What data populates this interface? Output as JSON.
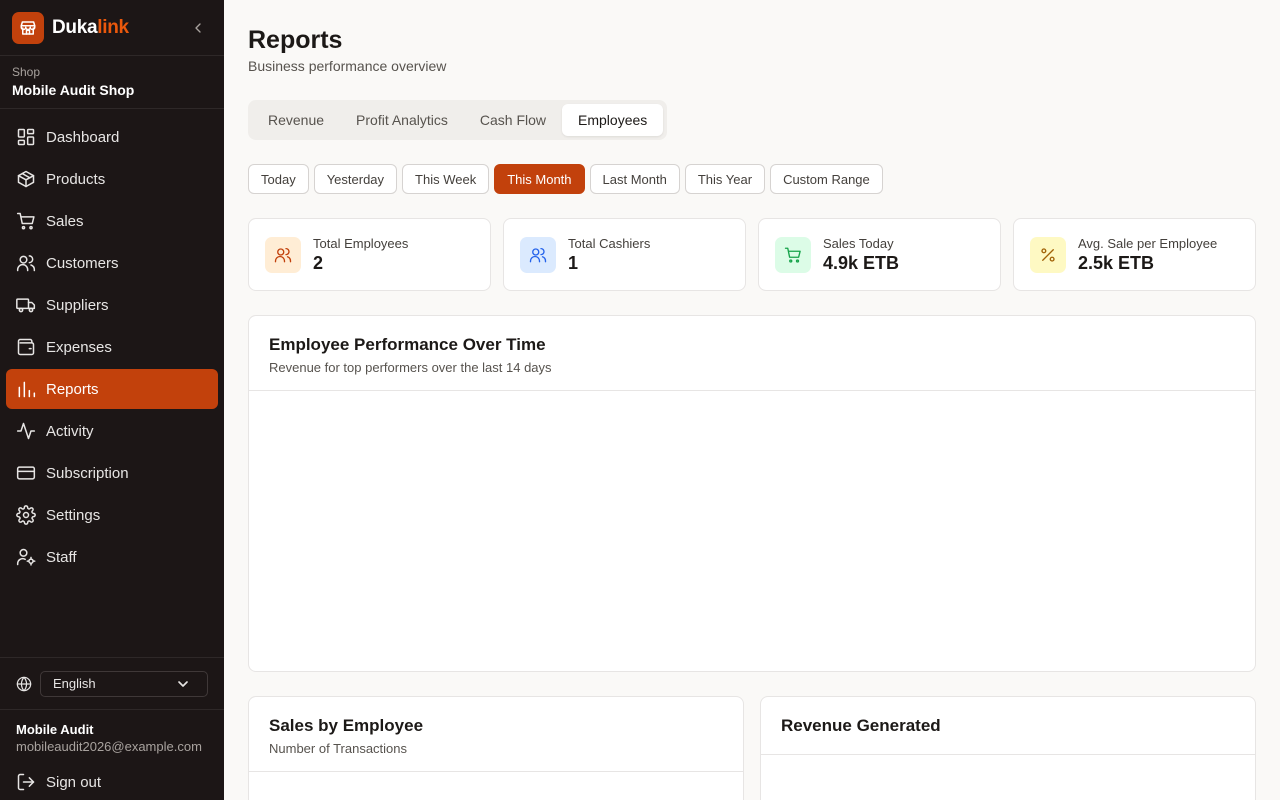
{
  "brand": {
    "name_part1": "Duka",
    "name_part2": "link",
    "logo_icon": "store-icon"
  },
  "shop": {
    "label": "Shop",
    "name": "Mobile Audit Shop"
  },
  "nav": [
    {
      "label": "Dashboard",
      "icon": "dashboard-icon"
    },
    {
      "label": "Products",
      "icon": "box-icon"
    },
    {
      "label": "Sales",
      "icon": "cart-icon"
    },
    {
      "label": "Customers",
      "icon": "users-icon"
    },
    {
      "label": "Suppliers",
      "icon": "truck-icon"
    },
    {
      "label": "Expenses",
      "icon": "wallet-icon"
    },
    {
      "label": "Reports",
      "icon": "bar-chart-icon",
      "active": true
    },
    {
      "label": "Activity",
      "icon": "activity-icon"
    },
    {
      "label": "Subscription",
      "icon": "credit-card-icon"
    },
    {
      "label": "Settings",
      "icon": "gear-icon"
    },
    {
      "label": "Staff",
      "icon": "user-cog-icon"
    }
  ],
  "language": {
    "selected": "English"
  },
  "user": {
    "name": "Mobile Audit",
    "email": "mobileaudit2026@example.com"
  },
  "signout_label": "Sign out",
  "page": {
    "title": "Reports",
    "subtitle": "Business performance overview"
  },
  "tabs": [
    "Revenue",
    "Profit Analytics",
    "Cash Flow",
    "Employees"
  ],
  "active_tab": "Employees",
  "ranges": [
    "Today",
    "Yesterday",
    "This Week",
    "This Month",
    "Last Month",
    "This Year",
    "Custom Range"
  ],
  "active_range": "This Month",
  "stats": [
    {
      "label": "Total Employees",
      "value": "2",
      "icon": "users-icon",
      "color": "#c2410c",
      "bg": "#ffedd5"
    },
    {
      "label": "Total Cashiers",
      "value": "1",
      "icon": "users-icon",
      "color": "#2563eb",
      "bg": "#dbeafe"
    },
    {
      "label": "Sales Today",
      "value": "4.9k ETB",
      "icon": "cart-icon",
      "color": "#16a34a",
      "bg": "#dcfce7"
    },
    {
      "label": "Avg. Sale per Employee",
      "value": "2.5k ETB",
      "icon": "percent-icon",
      "color": "#a16207",
      "bg": "#fef9c3"
    }
  ],
  "cards": {
    "performance": {
      "title": "Employee Performance Over Time",
      "subtitle": "Revenue for top performers over the last 14 days"
    },
    "sales_by_employee": {
      "title": "Sales by Employee",
      "subtitle": "Number of Transactions"
    },
    "revenue_generated": {
      "title": "Revenue Generated"
    }
  },
  "colors": {
    "accent": "#c2410c",
    "sidebar_bg": "#1c1616"
  }
}
